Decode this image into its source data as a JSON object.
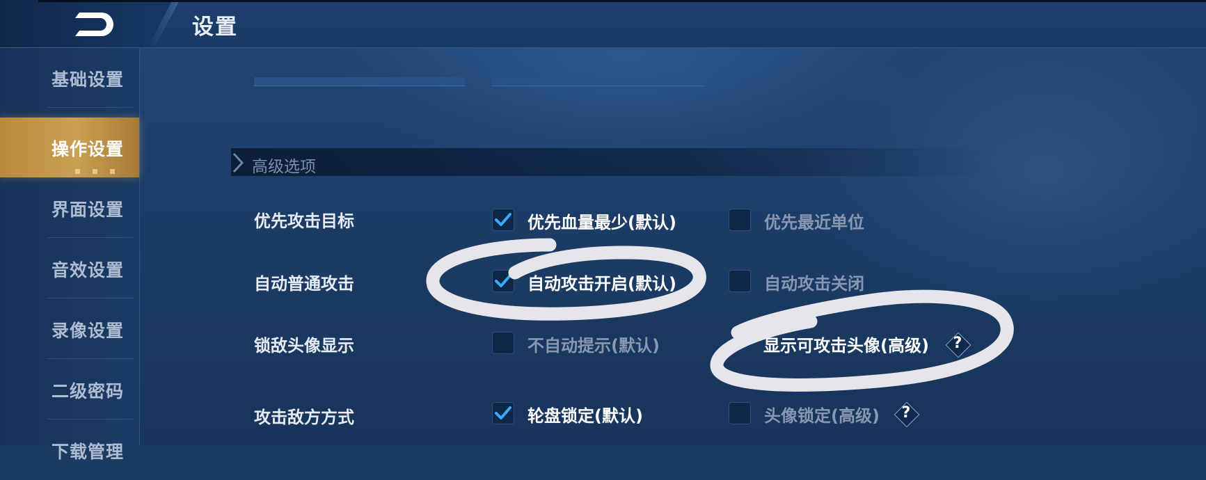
{
  "header": {
    "title": "设置"
  },
  "sidebar": {
    "items": [
      {
        "label": "基础设置",
        "active": false
      },
      {
        "label": "操作设置",
        "active": true
      },
      {
        "label": "界面设置",
        "active": false
      },
      {
        "label": "音效设置",
        "active": false
      },
      {
        "label": "录像设置",
        "active": false
      },
      {
        "label": "二级密码",
        "active": false
      },
      {
        "label": "下载管理",
        "active": false
      }
    ]
  },
  "section": {
    "title": "高级选项"
  },
  "rows": [
    {
      "label": "优先攻击目标",
      "options": [
        {
          "text": "优先血量最少(默认)",
          "checked": true
        },
        {
          "text": "优先最近单位",
          "checked": false
        }
      ]
    },
    {
      "label": "自动普通攻击",
      "options": [
        {
          "text": "自动攻击开启(默认)",
          "checked": true
        },
        {
          "text": "自动攻击关闭",
          "checked": false
        }
      ]
    },
    {
      "label": "锁敌头像显示",
      "options": [
        {
          "text": "不自动提示(默认)",
          "checked": false
        },
        {
          "text": "显示可攻击头像(高级)",
          "checked": false,
          "help": "?"
        }
      ]
    },
    {
      "label": "攻击敌方方式",
      "options": [
        {
          "text": "轮盘锁定(默认)",
          "checked": true
        },
        {
          "text": "头像锁定(高级)",
          "checked": false,
          "help": "?"
        }
      ]
    }
  ],
  "colors": {
    "accent_gold": "#c89a4c",
    "check_blue": "#3aa8ff",
    "background": "#1d3e69"
  }
}
